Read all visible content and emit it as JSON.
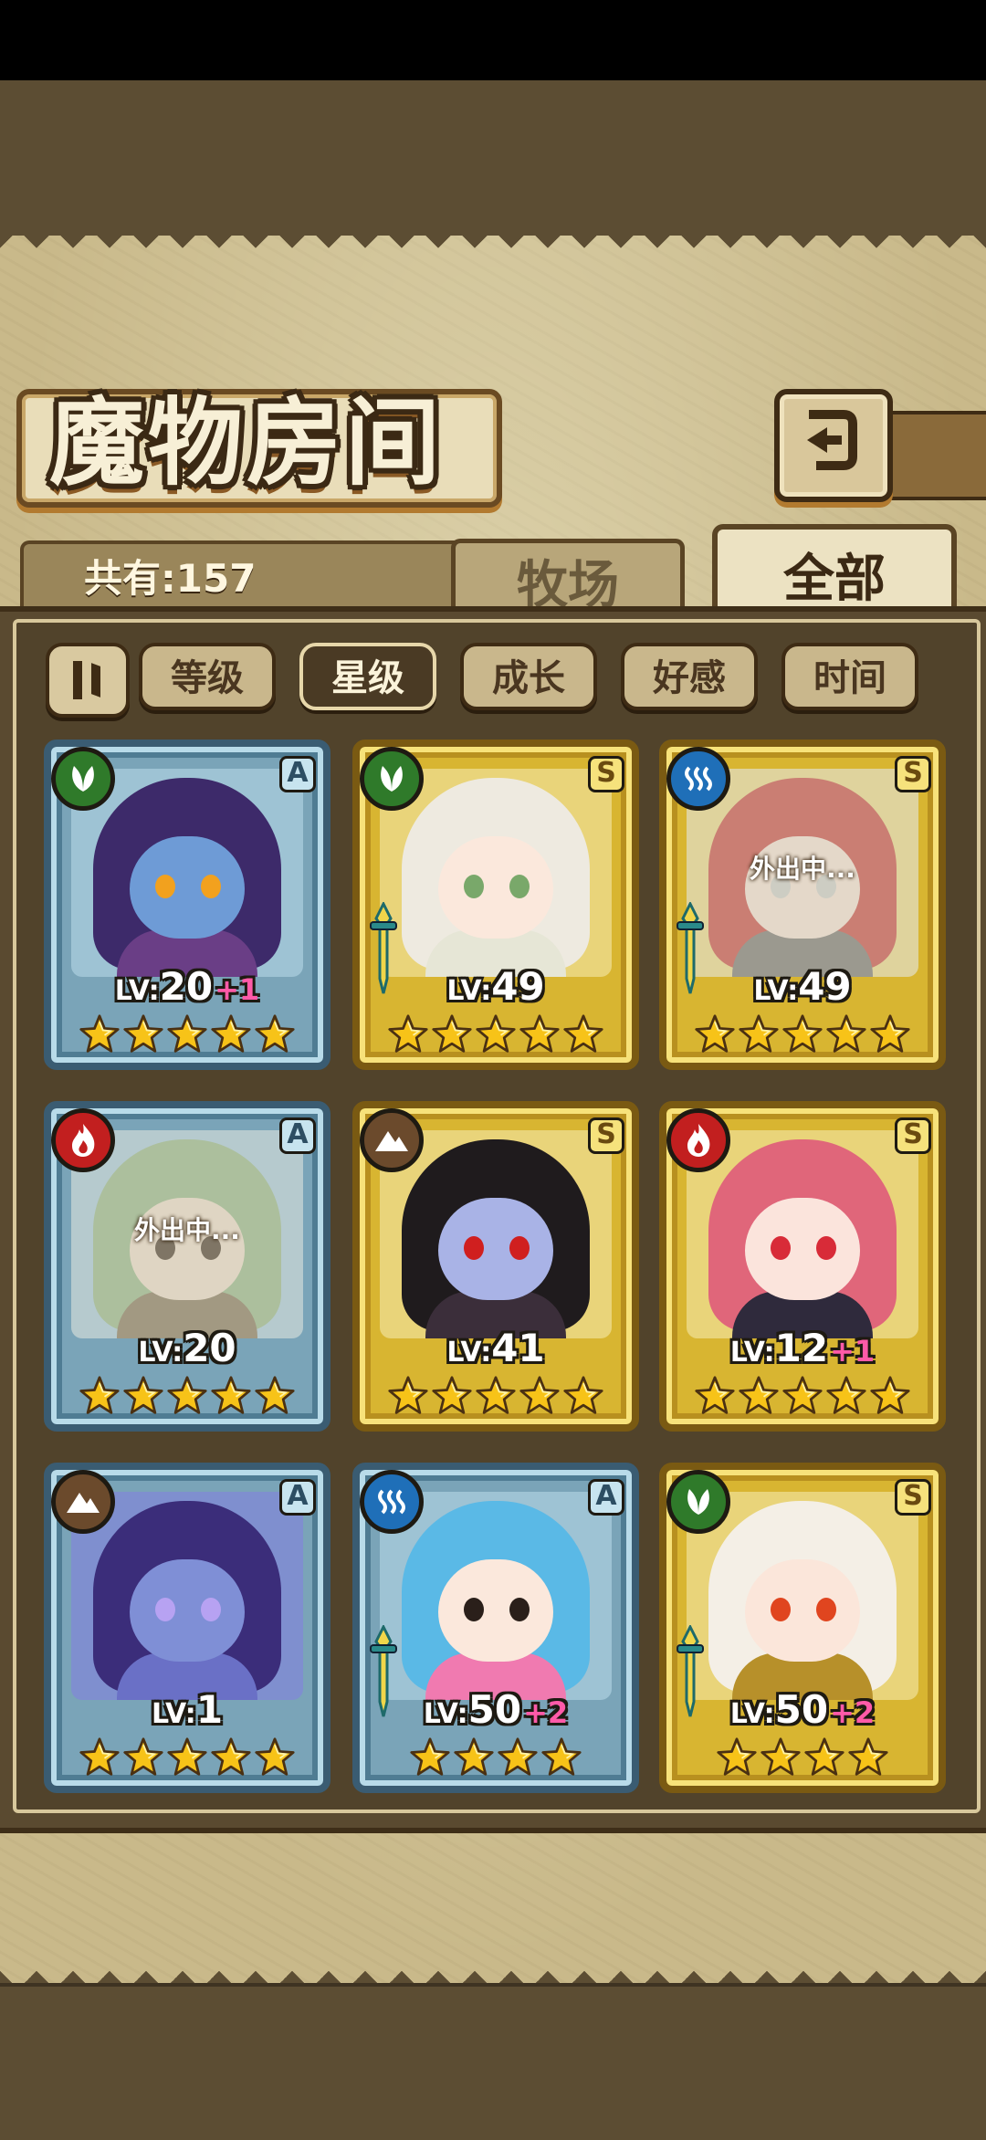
{
  "header": {
    "title": "魔物房间",
    "back_icon": "return-arrow-icon"
  },
  "summary": {
    "total_label": "共有:157"
  },
  "tabs": [
    {
      "label": "牧场",
      "active": false
    },
    {
      "label": "全部",
      "active": true
    }
  ],
  "sort": {
    "toggle_icon": "sort-order-toggle-icon",
    "buttons": [
      {
        "label": "等级",
        "active": false
      },
      {
        "label": "星级",
        "active": true
      },
      {
        "label": "成长",
        "active": false
      },
      {
        "label": "好感",
        "active": false
      },
      {
        "label": "时间",
        "active": false
      }
    ]
  },
  "colors": {
    "rank_A_frame": "#7aa4b8",
    "rank_S_frame": "#d8b531",
    "element_leaf": "#2f7a2a",
    "element_water": "#1f6fb8",
    "element_fire": "#c21f1f",
    "element_earth": "#6b4a2c",
    "level_bonus": "#ff5aa8",
    "star": "#f7c318"
  },
  "monsters": [
    {
      "element": "leaf",
      "rank": "A",
      "level": "20",
      "bonus": "+1",
      "stars": 5,
      "away": "",
      "weapon": false
    },
    {
      "element": "leaf",
      "rank": "S",
      "level": "49",
      "bonus": "",
      "stars": 5,
      "away": "",
      "weapon": true
    },
    {
      "element": "water",
      "rank": "S",
      "level": "49",
      "bonus": "",
      "stars": 5,
      "away": "外出中...",
      "weapon": true
    },
    {
      "element": "fire",
      "rank": "A",
      "level": "20",
      "bonus": "",
      "stars": 5,
      "away": "外出中...",
      "weapon": false
    },
    {
      "element": "earth",
      "rank": "S",
      "level": "41",
      "bonus": "",
      "stars": 5,
      "away": "",
      "weapon": false
    },
    {
      "element": "fire",
      "rank": "S",
      "level": "12",
      "bonus": "+1",
      "stars": 5,
      "away": "",
      "weapon": false
    },
    {
      "element": "earth",
      "rank": "A",
      "level": "1",
      "bonus": "",
      "stars": 5,
      "away": "",
      "weapon": false
    },
    {
      "element": "water",
      "rank": "A",
      "level": "50",
      "bonus": "+2",
      "stars": 4,
      "away": "",
      "weapon": true
    },
    {
      "element": "leaf",
      "rank": "S",
      "level": "50",
      "bonus": "+2",
      "stars": 4,
      "away": "",
      "weapon": true
    }
  ],
  "level_prefix": "LV:"
}
